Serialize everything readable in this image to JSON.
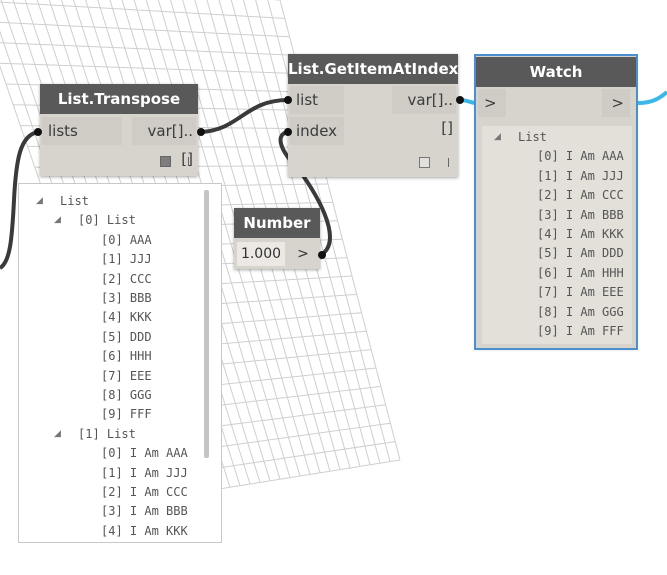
{
  "nodes": {
    "transpose": {
      "title": "List.Transpose",
      "input": "lists",
      "output": "var[]..[]"
    },
    "getitem": {
      "title": "List.GetItemAtIndex",
      "input1": "list",
      "input2": "index",
      "output": "var[]..[]"
    },
    "number": {
      "title": "Number",
      "value": "1.000",
      "arrow": ">"
    },
    "watch": {
      "title": "Watch",
      "in_port": ">",
      "out_port": ">"
    }
  },
  "transpose_preview": {
    "root": "List",
    "group0": "[0] List",
    "group0_items": [
      "[0] AAA",
      "[1] JJJ",
      "[2] CCC",
      "[3] BBB",
      "[4] KKK",
      "[5] DDD",
      "[6] HHH",
      "[7] EEE",
      "[8] GGG",
      "[9] FFF"
    ],
    "group1": "[1] List",
    "group1_items": [
      "[0] I Am AAA",
      "[1] I Am JJJ",
      "[2] I Am CCC",
      "[3] I Am BBB",
      "[4] I Am KKK"
    ]
  },
  "watch_tree": {
    "root": "List",
    "items": [
      "[0] I Am AAA",
      "[1] I Am JJJ",
      "[2] I Am CCC",
      "[3] I Am BBB",
      "[4] I Am KKK",
      "[5] I Am DDD",
      "[6] I Am HHH",
      "[7] I Am EEE",
      "[8] I Am GGG",
      "[9] I Am FFF"
    ]
  },
  "colors": {
    "header": "#595959",
    "body": "#d7d3cd",
    "wire": "#3a3a3a",
    "selection": "#4b8fd0",
    "watch_wire": "#3bb8e8"
  }
}
